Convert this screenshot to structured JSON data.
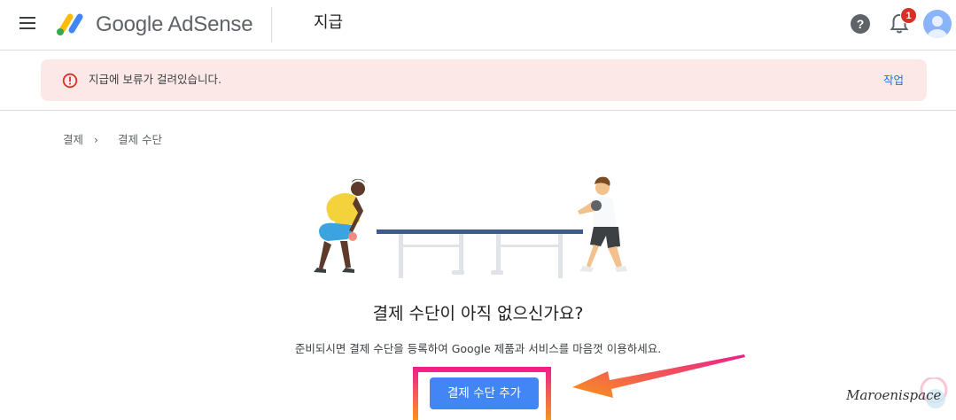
{
  "header": {
    "brand": "Google AdSense",
    "page_title": "지급",
    "notification_count": "1",
    "help_glyph": "?",
    "icons": [
      "menu-icon",
      "adsense-logo",
      "help-icon",
      "bell-icon",
      "avatar"
    ]
  },
  "alert": {
    "message": "지급에 보류가 걸려있습니다.",
    "action": "작업",
    "icon": "error-icon"
  },
  "breadcrumb": {
    "items": [
      "결제",
      "결제 수단"
    ],
    "separator": "›"
  },
  "empty_state": {
    "title": "결제 수단이 아직 없으신가요?",
    "description": "준비되시면 결제 수단을 등록하여 Google 제품과 서비스를 마음껏 이용하세요.",
    "button_label": "결제 수단 추가"
  },
  "watermark": "Maroenispace",
  "colors": {
    "accent": "#4285f4",
    "alert_bg": "#fce8e6",
    "error": "#d93025",
    "highlight_frame": [
      "#ee1c8c",
      "#f7941d"
    ],
    "arrow": [
      "#ee1c8c",
      "#f7941d"
    ]
  }
}
